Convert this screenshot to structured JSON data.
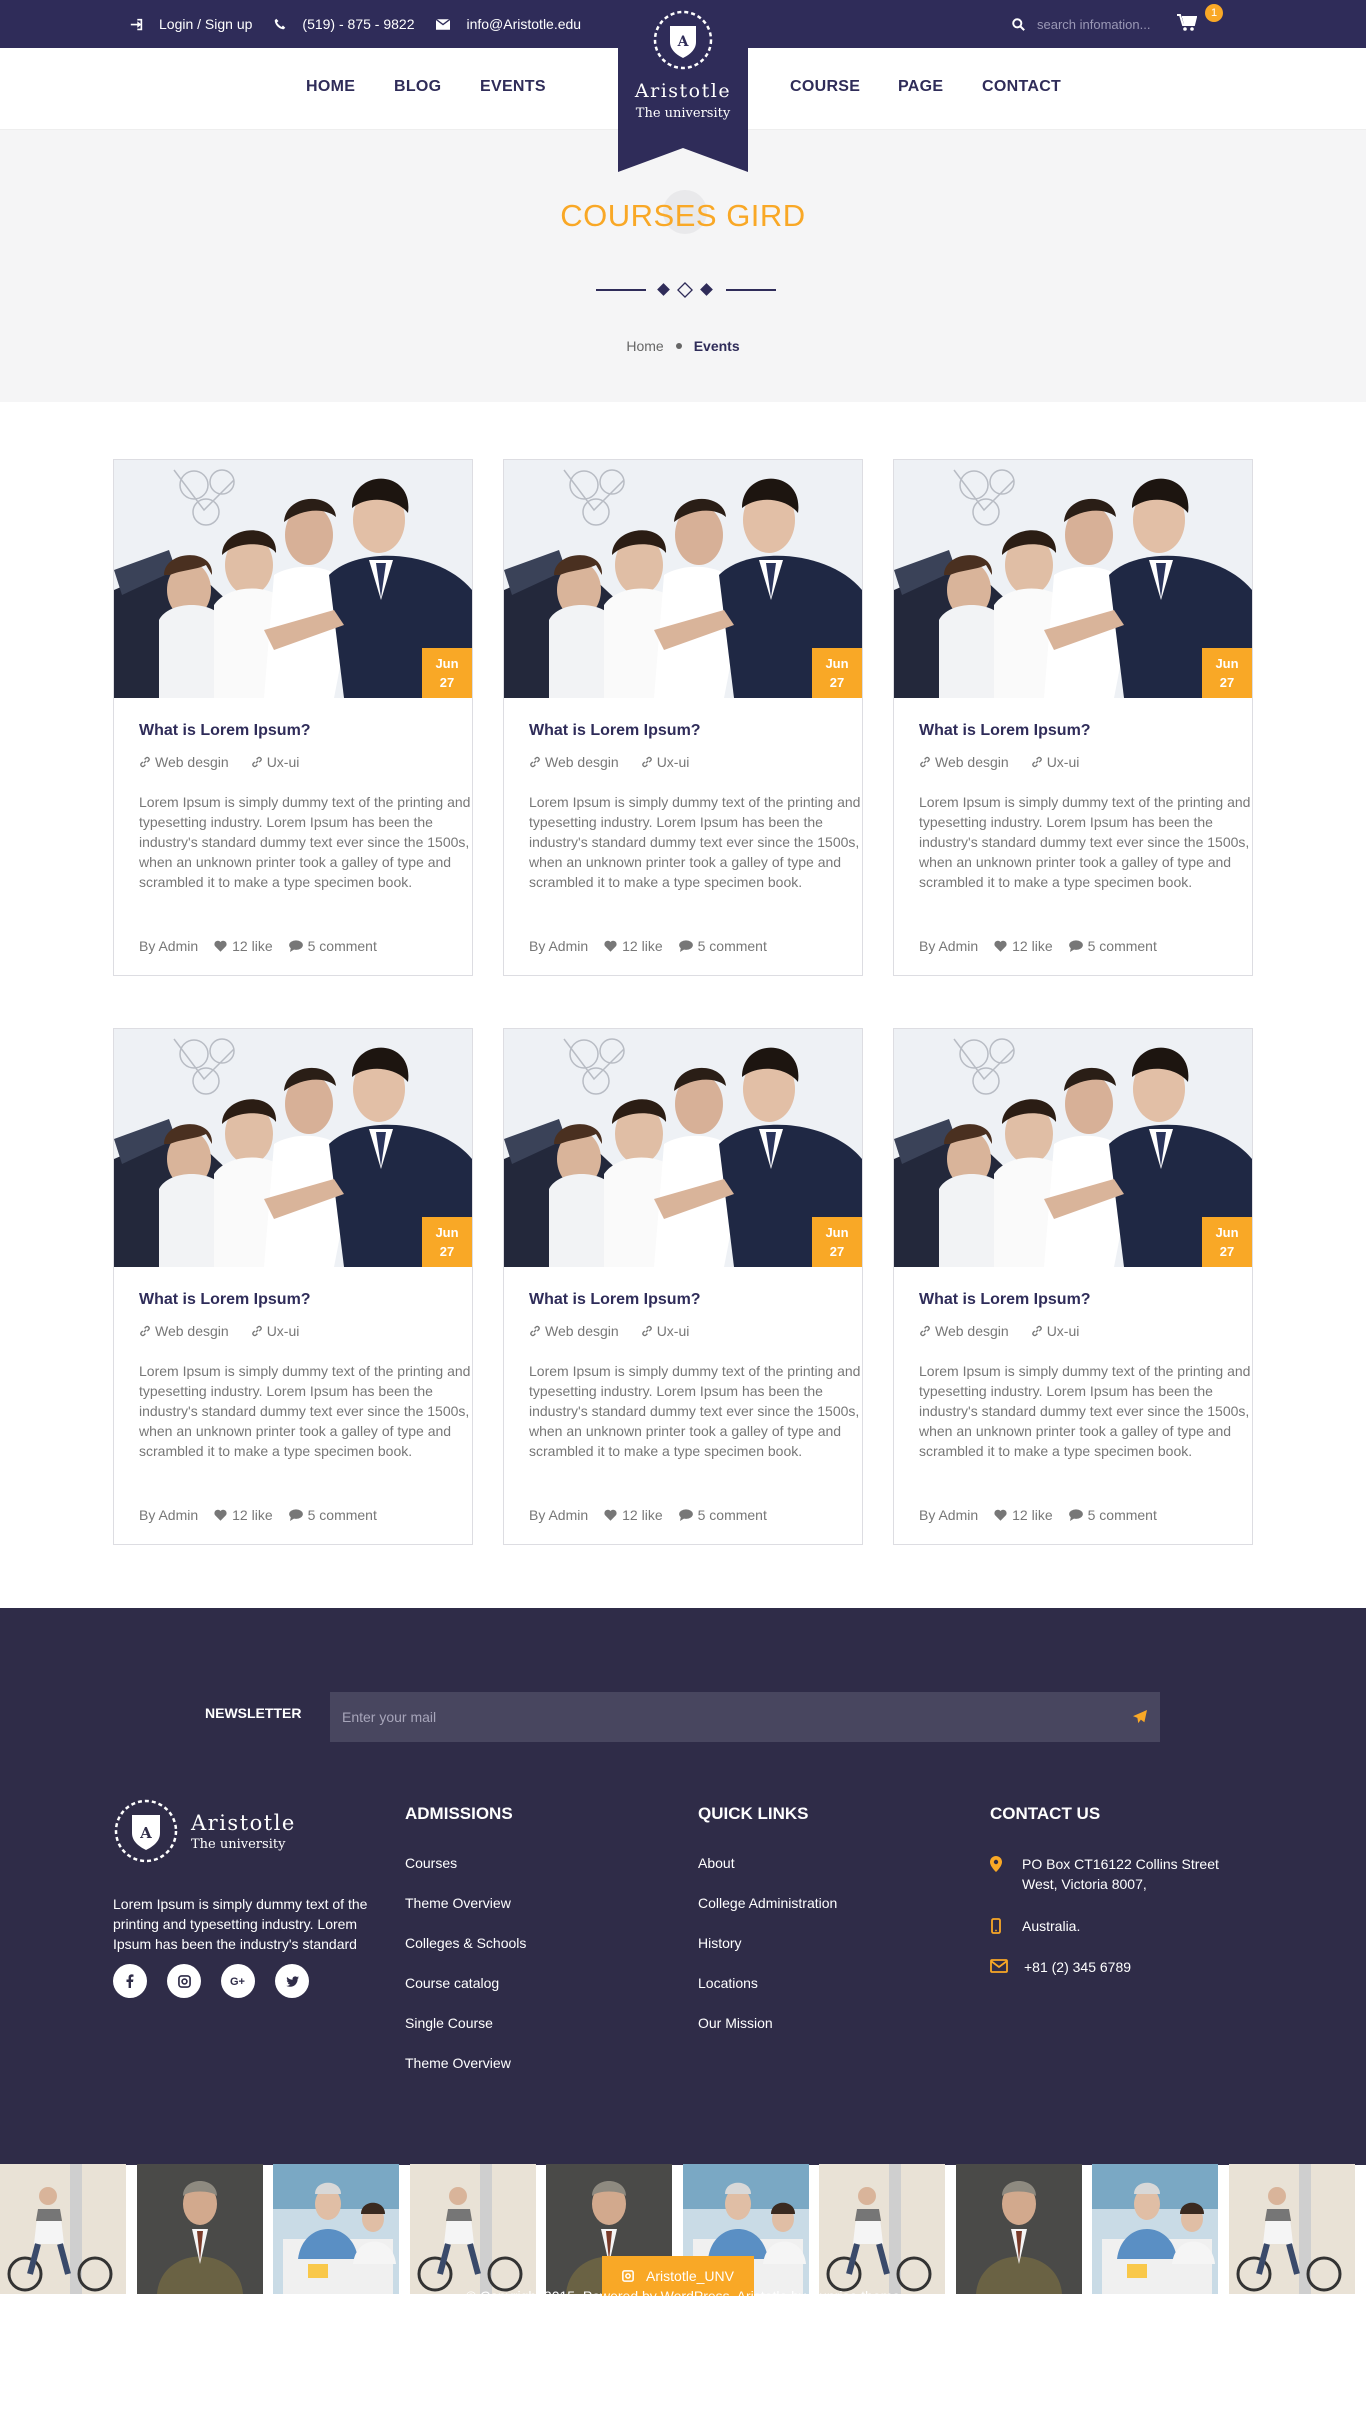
{
  "topbar": {
    "login": "Login / Sign up",
    "phone": "(519) - 875 - 9822",
    "email": "info@Aristotle.edu",
    "search_placeholder": "search infomation...",
    "cart_count": "1"
  },
  "nav": {
    "left": [
      "HOME",
      "BLOG",
      "EVENTS"
    ],
    "right": [
      "COURSE",
      "PAGE",
      "CONTACT"
    ],
    "logo_name": "Aristotle",
    "logo_sub": "The university"
  },
  "hero": {
    "title": "COURSES GIRD",
    "breadcrumb_home": "Home",
    "breadcrumb_current": "Events"
  },
  "cards": [
    {
      "month": "Jun",
      "day": "27",
      "title": "What is Lorem Ipsum?",
      "tag1": "Web desgin",
      "tag2": "Ux-ui",
      "desc": "Lorem Ipsum is simply dummy text of the printing and typesetting industry. Lorem Ipsum has been the industry's standard dummy text ever since the 1500s, when an unknown printer took a galley of type and scrambled it to make a type specimen book.",
      "author": "By Admin",
      "likes": "12 like",
      "comments": "5 comment"
    },
    {
      "month": "Jun",
      "day": "27",
      "title": "What is Lorem Ipsum?",
      "tag1": "Web desgin",
      "tag2": "Ux-ui",
      "desc": "Lorem Ipsum is simply dummy text of the printing and typesetting industry. Lorem Ipsum has been the industry's standard dummy text ever since the 1500s, when an unknown printer took a galley of type and scrambled it to make a type specimen book.",
      "author": "By Admin",
      "likes": "12 like",
      "comments": "5 comment"
    },
    {
      "month": "Jun",
      "day": "27",
      "title": "What is Lorem Ipsum?",
      "tag1": "Web desgin",
      "tag2": "Ux-ui",
      "desc": "Lorem Ipsum is simply dummy text of the printing and typesetting industry. Lorem Ipsum has been the industry's standard dummy text ever since the 1500s, when an unknown printer took a galley of type and scrambled it to make a type specimen book.",
      "author": "By Admin",
      "likes": "12 like",
      "comments": "5 comment"
    },
    {
      "month": "Jun",
      "day": "27",
      "title": "What is Lorem Ipsum?",
      "tag1": "Web desgin",
      "tag2": "Ux-ui",
      "desc": "Lorem Ipsum is simply dummy text of the printing and typesetting industry. Lorem Ipsum has been the industry's standard dummy text ever since the 1500s, when an unknown printer took a galley of type and scrambled it to make a type specimen book.",
      "author": "By Admin",
      "likes": "12 like",
      "comments": "5 comment"
    },
    {
      "month": "Jun",
      "day": "27",
      "title": "What is Lorem Ipsum?",
      "tag1": "Web desgin",
      "tag2": "Ux-ui",
      "desc": "Lorem Ipsum is simply dummy text of the printing and typesetting industry. Lorem Ipsum has been the industry's standard dummy text ever since the 1500s, when an unknown printer took a galley of type and scrambled it to make a type specimen book.",
      "author": "By Admin",
      "likes": "12 like",
      "comments": "5 comment"
    },
    {
      "month": "Jun",
      "day": "27",
      "title": "What is Lorem Ipsum?",
      "tag1": "Web desgin",
      "tag2": "Ux-ui",
      "desc": "Lorem Ipsum is simply dummy text of the printing and typesetting industry. Lorem Ipsum has been the industry's standard dummy text ever since the 1500s, when an unknown printer took a galley of type and scrambled it to make a type specimen book.",
      "author": "By Admin",
      "likes": "12 like",
      "comments": "5 comment"
    }
  ],
  "footer": {
    "newsletter_label": "NEWSLETTER",
    "newsletter_placeholder": "Enter your mail",
    "logo_name": "Aristotle",
    "logo_sub": "The university",
    "description": "Lorem Ipsum is simply dummy text of the printing and typesetting industry. Lorem Ipsum has been the industry's standard",
    "admissions_title": "ADMISSIONS",
    "admissions": [
      "Courses",
      "Theme Overview",
      "Colleges & Schools",
      "Course catalog",
      "Single Course",
      "Theme Overview"
    ],
    "quick_links_title": "QUICK LINKS",
    "quick_links": [
      "About",
      "College Administration",
      "History",
      "Locations",
      "Our Mission"
    ],
    "contact_title": "CONTACT US",
    "contact_address": "PO Box CT16122 Collins Street West, Victoria 8007,",
    "contact_country": "Australia.",
    "contact_phone": "+81 (2) 345 6789",
    "instagram_label": "Aristotle_UNV",
    "copyright": "© Copyright 2015. Powered by WordPress. Aristotle by Sunrise theme"
  },
  "colors": {
    "primary": "#2f2c59",
    "accent": "#f9a826",
    "footer_bg": "#2f2c48"
  },
  "icons": [
    "sign-in-icon",
    "phone-icon",
    "envelope-icon",
    "search-icon",
    "cart-icon",
    "link-icon",
    "heart-icon",
    "comment-icon",
    "send-icon",
    "map-pin-icon",
    "mobile-icon",
    "facebook-icon",
    "instagram-icon",
    "google-plus-icon",
    "twitter-icon"
  ]
}
